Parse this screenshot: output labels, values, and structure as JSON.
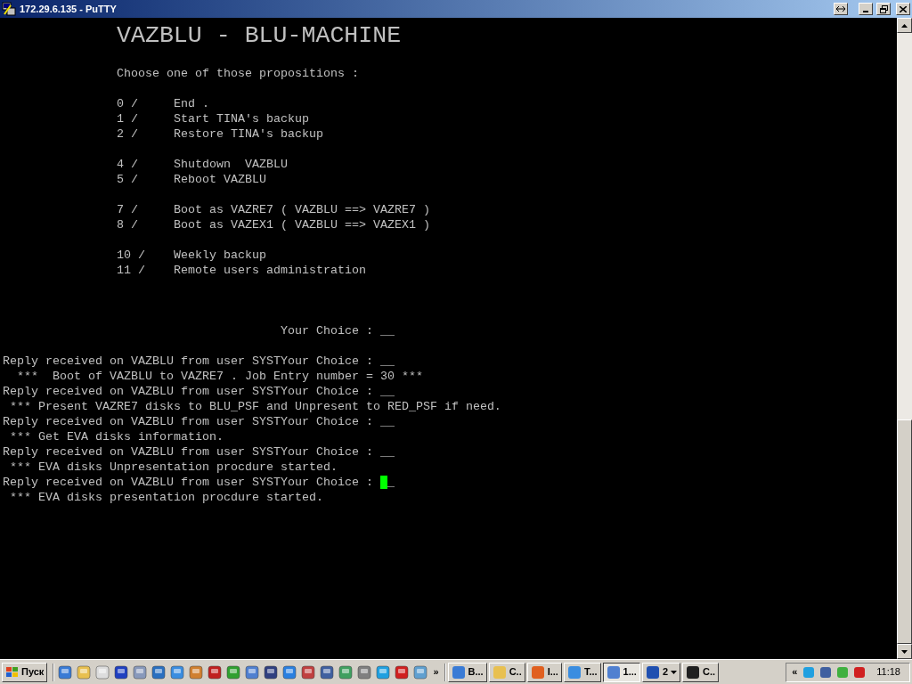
{
  "window": {
    "title": "172.29.6.135 - PuTTY"
  },
  "terminal": {
    "title": "VAZBLU - BLU-MACHINE",
    "prompt": "Choose one of those propositions :",
    "menu_groups": [
      [
        {
          "number": "0 /",
          "label": "End ."
        },
        {
          "number": "1 /",
          "label": "Start TINA's backup"
        },
        {
          "number": "2 /",
          "label": "Restore TINA's backup"
        }
      ],
      [
        {
          "number": "4 /",
          "label": "Shutdown  VAZBLU"
        },
        {
          "number": "5 /",
          "label": "Reboot VAZBLU"
        }
      ],
      [
        {
          "number": "7 /",
          "label": "Boot as VAZRE7 ( VAZBLU ==> VAZRE7 )"
        },
        {
          "number": "8 /",
          "label": "Boot as VAZEX1 ( VAZBLU ==> VAZEX1 )"
        }
      ],
      [
        {
          "number": "10 /",
          "label": "Weekly backup"
        },
        {
          "number": "11 /",
          "label": "Remote users administration"
        }
      ]
    ],
    "choice": "Your Choice : __",
    "log": [
      {
        "text": "Reply received on VAZBLU from user SYSTYour Choice : __",
        "cursor": false
      },
      {
        "text": "  ***  Boot of VAZBLU to VAZRE7 . Job Entry number = 30 ***",
        "cursor": false
      },
      {
        "text": "Reply received on VAZBLU from user SYSTYour Choice : __",
        "cursor": false
      },
      {
        "text": " *** Present VAZRE7 disks to BLU_PSF and Unpresent to RED_PSF if need.",
        "cursor": false
      },
      {
        "text": "Reply received on VAZBLU from user SYSTYour Choice : __",
        "cursor": false
      },
      {
        "text": " *** Get EVA disks information.",
        "cursor": false
      },
      {
        "text": "Reply received on VAZBLU from user SYSTYour Choice : __",
        "cursor": false
      },
      {
        "text": " *** EVA disks Unpresentation procdure started.",
        "cursor": false
      },
      {
        "text": "Reply received on VAZBLU from user SYSTYour Choice : ",
        "cursor": true,
        "after_cursor": "_"
      },
      {
        "text": " *** EVA disks presentation procdure started.",
        "cursor": false
      }
    ]
  },
  "taskbar": {
    "start": "Пуск",
    "more": "»",
    "tasks": [
      {
        "label": "B...",
        "selected": false
      },
      {
        "label": "C..",
        "selected": false
      },
      {
        "label": "I...",
        "selected": false
      },
      {
        "label": "T...",
        "selected": false
      },
      {
        "label": "1...",
        "selected": true
      },
      {
        "label": "2",
        "selected": false
      },
      {
        "label": "C..",
        "selected": false
      }
    ],
    "tray_toggle": "«",
    "clock": "11:18"
  }
}
